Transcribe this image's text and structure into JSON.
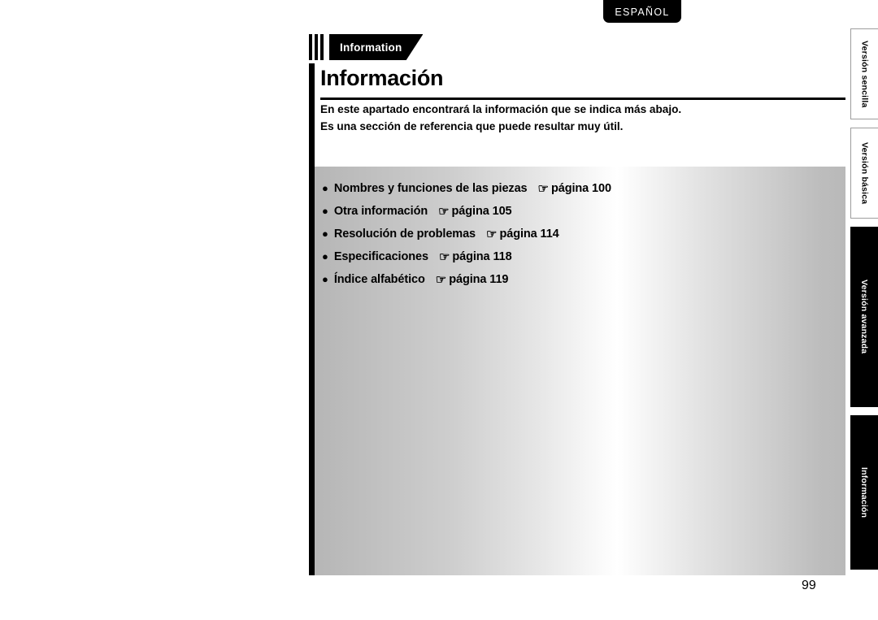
{
  "language_badge": {
    "label": "ESPAÑOL"
  },
  "section_tab": {
    "label": "Information"
  },
  "header": {
    "title": "Información",
    "intro_line_1": "En este apartado encontrará la información que se indica más abajo.",
    "intro_line_2": "Es una sección de referencia que puede resultar muy útil."
  },
  "contents": {
    "bullet_glyph": "●",
    "hand_glyph": "☞",
    "items": [
      {
        "label": "Nombres y funciones de las piezas",
        "reference": "página 100"
      },
      {
        "label": "Otra información",
        "reference": "página 105"
      },
      {
        "label": "Resolución de problemas",
        "reference": "página 114"
      },
      {
        "label": "Especificaciones",
        "reference": "página 118"
      },
      {
        "label": "Índice alfabético",
        "reference": "página 119"
      }
    ]
  },
  "side_tabs": [
    {
      "label": "Versión sencilla",
      "state": "inactive"
    },
    {
      "label": "Versión básica",
      "state": "inactive"
    },
    {
      "label": "Versión avanzada",
      "state": "active"
    },
    {
      "label": "Información",
      "state": "active"
    }
  ],
  "footer": {
    "page_number": "99"
  }
}
